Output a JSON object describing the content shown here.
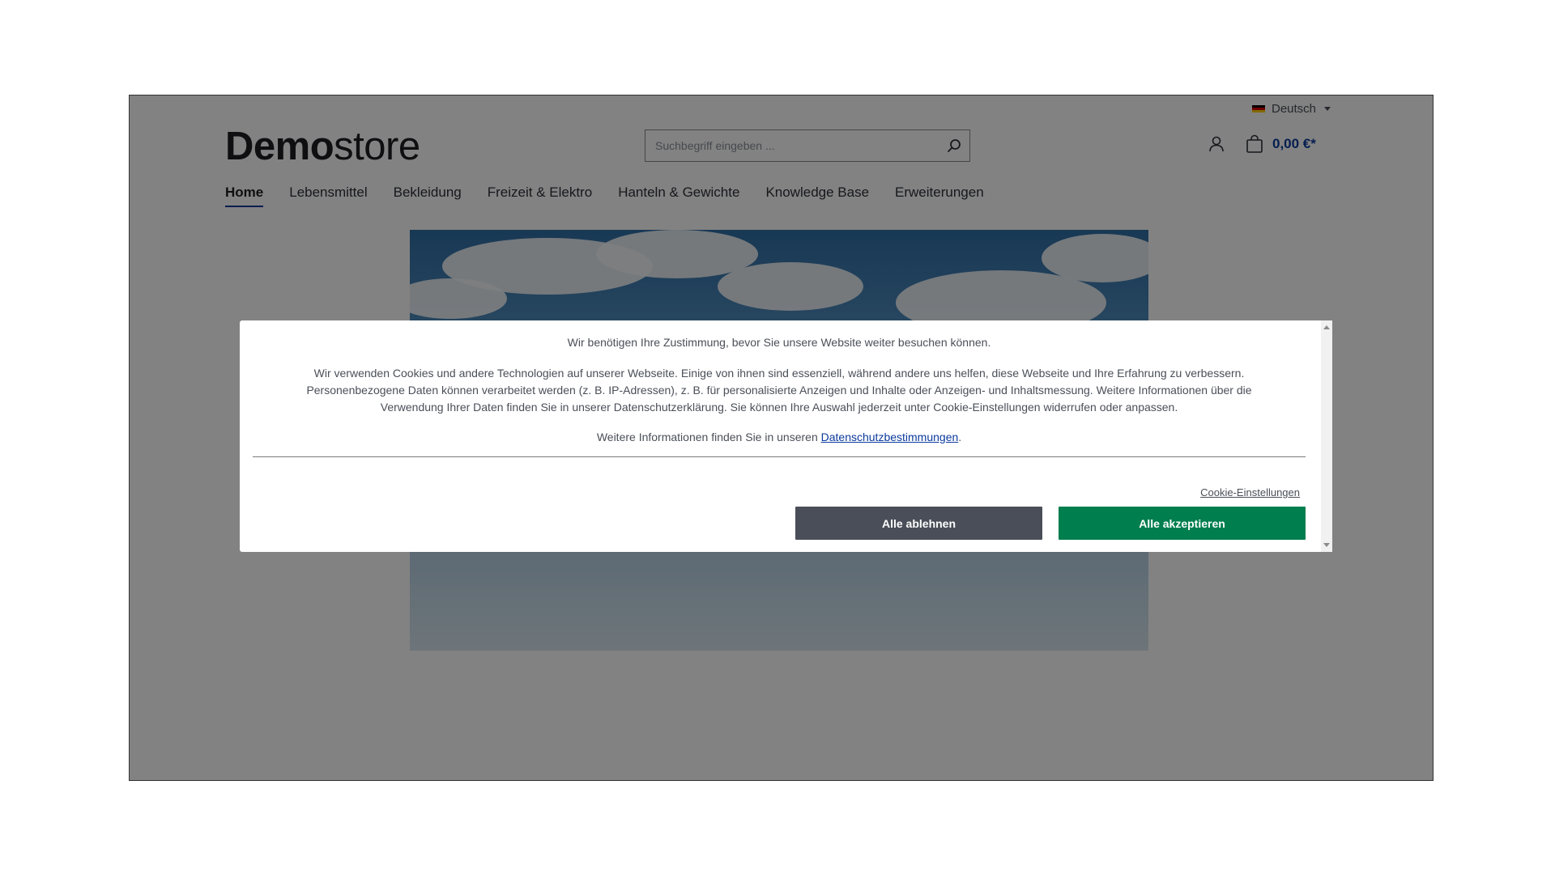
{
  "colors": {
    "accent": "#0b3a9e",
    "decline_button": "#4a4e58",
    "accept_button": "#007e4e",
    "overlay": "rgba(0,0,0,0.49)"
  },
  "header": {
    "language": {
      "label": "Deutsch",
      "flag_icon": "germany-flag-icon"
    },
    "logo": {
      "bold": "Demo",
      "light": "store"
    },
    "search": {
      "placeholder": "Suchbegriff eingeben ...",
      "value": ""
    },
    "cart_total": "0,00 €*"
  },
  "nav": {
    "items": [
      {
        "label": "Home",
        "active": true
      },
      {
        "label": "Lebensmittel",
        "active": false
      },
      {
        "label": "Bekleidung",
        "active": false
      },
      {
        "label": "Freizeit & Elektro",
        "active": false
      },
      {
        "label": "Hanteln & Gewichte",
        "active": false
      },
      {
        "label": "Knowledge Base",
        "active": false
      },
      {
        "label": "Erweiterungen",
        "active": false
      }
    ]
  },
  "cookie_modal": {
    "headline": "Wir benötigen Ihre Zustimmung, bevor Sie unsere Website weiter besuchen können.",
    "text_line1": "Wir verwenden Cookies und andere Technologien auf unserer Webseite. Einige von ihnen sind essenziell, während andere uns helfen, diese Webseite und Ihre Erfahrung zu verbessern.",
    "text_line2": "Personenbezogene Daten können verarbeitet werden (z. B. IP-Adressen), z. B. für personalisierte Anzeigen und Inhalte oder Anzeigen- und Inhaltsmessung. Weitere Informationen über die",
    "text_line3": "Verwendung Ihrer Daten finden Sie in unserer Datenschutzerklärung. Sie können Ihre Auswahl jederzeit unter Cookie-Einstellungen widerrufen oder anpassen.",
    "more_info_prefix": "Weitere Informationen finden Sie in unseren ",
    "privacy_link": "Datenschutzbestimmungen",
    "more_info_suffix": ".",
    "settings_link": "Cookie-Einstellungen",
    "decline_label": "Alle ablehnen",
    "accept_label": "Alle akzeptieren"
  }
}
